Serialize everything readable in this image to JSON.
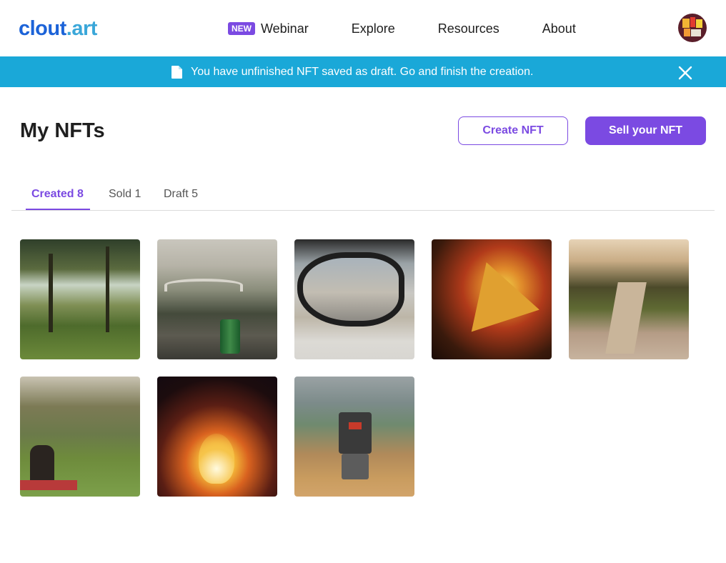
{
  "header": {
    "logo_part1": "clout",
    "logo_part2": ".art",
    "nav": [
      {
        "label": "Webinar",
        "badge": "NEW"
      },
      {
        "label": "Explore"
      },
      {
        "label": "Resources"
      },
      {
        "label": "About"
      }
    ],
    "avatar_icon": "user-avatar-icon"
  },
  "banner": {
    "icon": "document-icon",
    "text": "You have unfinished NFT saved as draft. Go and finish the creation.",
    "close_icon": "close-icon",
    "background": "#1aa8d8"
  },
  "page": {
    "title": "My NFTs",
    "create_button": "Create NFT",
    "sell_button": "Sell your NFT",
    "accent": "#7b4ae2"
  },
  "tabs": [
    {
      "label": "Created 8",
      "active": true
    },
    {
      "label": "Sold 1",
      "active": false
    },
    {
      "label": "Draft 5",
      "active": false
    }
  ],
  "nft_grid": {
    "items": [
      {
        "subject": "trees in a park"
      },
      {
        "subject": "bridge over a river with a can"
      },
      {
        "subject": "car side mirror reflecting a city"
      },
      {
        "subject": "warning road sign at night"
      },
      {
        "subject": "rocky stream at sunset"
      },
      {
        "subject": "people sitting in a park"
      },
      {
        "subject": "bonfire at night"
      },
      {
        "subject": "lego robot on a table"
      }
    ]
  }
}
